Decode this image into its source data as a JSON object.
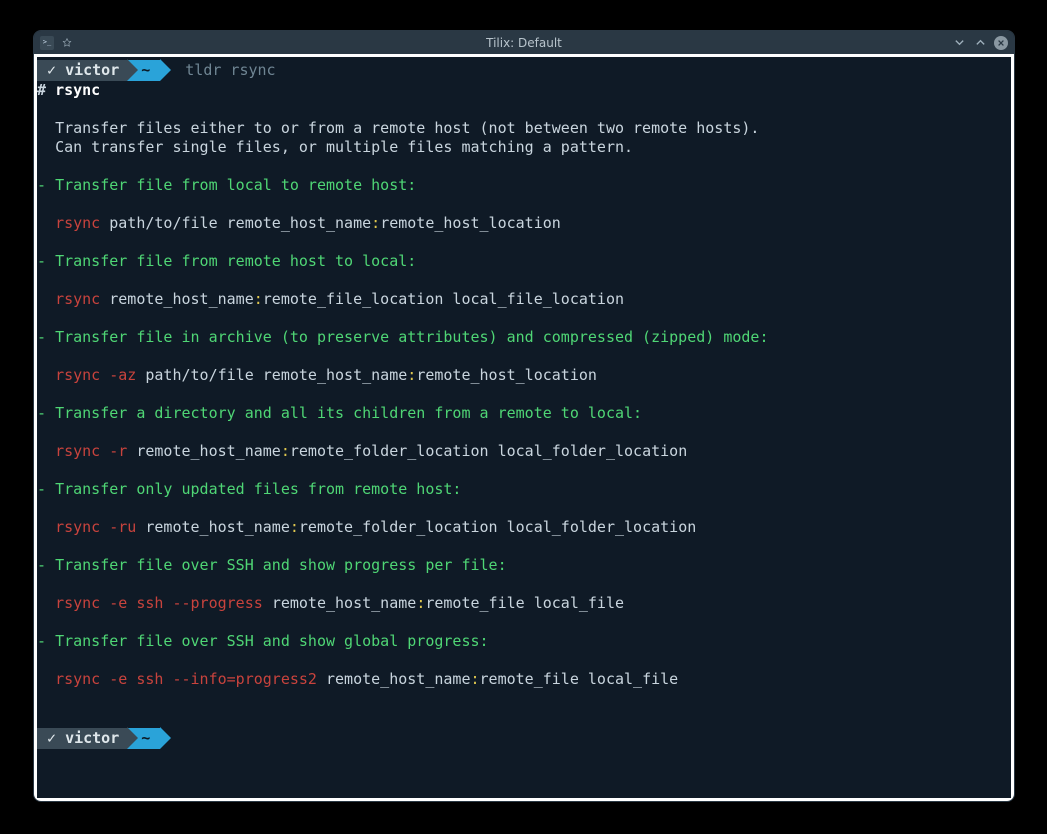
{
  "window": {
    "title": "Tilix: Default"
  },
  "prompt": {
    "check": "✓",
    "user": "victor",
    "cwd": "~",
    "command": "tldr rsync"
  },
  "output": {
    "heading_hash": "#",
    "heading": "rsync",
    "description_line1": "Transfer files either to or from a remote host (not between two remote hosts).",
    "description_line2": "Can transfer single files, or multiple files matching a pattern.",
    "examples": [
      {
        "desc": "Transfer file from local to remote host:",
        "cmd": "rsync",
        "flags": "",
        "seg": [
          {
            "t": "param",
            "v": "path/to/file remote_host_name"
          },
          {
            "t": "colon",
            "v": ":"
          },
          {
            "t": "param",
            "v": "remote_host_location"
          }
        ]
      },
      {
        "desc": "Transfer file from remote host to local:",
        "cmd": "rsync",
        "flags": "",
        "seg": [
          {
            "t": "param",
            "v": "remote_host_name"
          },
          {
            "t": "colon",
            "v": ":"
          },
          {
            "t": "param",
            "v": "remote_file_location local_file_location"
          }
        ]
      },
      {
        "desc": "Transfer file in archive (to preserve attributes) and compressed (zipped) mode:",
        "cmd": "rsync",
        "flags": "-az",
        "seg": [
          {
            "t": "param",
            "v": "path/to/file remote_host_name"
          },
          {
            "t": "colon",
            "v": ":"
          },
          {
            "t": "param",
            "v": "remote_host_location"
          }
        ]
      },
      {
        "desc": "Transfer a directory and all its children from a remote to local:",
        "cmd": "rsync",
        "flags": "-r",
        "seg": [
          {
            "t": "param",
            "v": "remote_host_name"
          },
          {
            "t": "colon",
            "v": ":"
          },
          {
            "t": "param",
            "v": "remote_folder_location local_folder_location"
          }
        ]
      },
      {
        "desc": "Transfer only updated files from remote host:",
        "cmd": "rsync",
        "flags": "-ru",
        "seg": [
          {
            "t": "param",
            "v": "remote_host_name"
          },
          {
            "t": "colon",
            "v": ":"
          },
          {
            "t": "param",
            "v": "remote_folder_location local_folder_location"
          }
        ]
      },
      {
        "desc": "Transfer file over SSH and show progress per file:",
        "cmd": "rsync",
        "flags": "-e ssh --progress",
        "seg": [
          {
            "t": "param",
            "v": "remote_host_name"
          },
          {
            "t": "colon",
            "v": ":"
          },
          {
            "t": "param",
            "v": "remote_file local_file"
          }
        ]
      },
      {
        "desc": "Transfer file over SSH and show global progress:",
        "cmd": "rsync",
        "flags": "-e ssh --info=progress2",
        "seg": [
          {
            "t": "param",
            "v": "remote_host_name"
          },
          {
            "t": "colon",
            "v": ":"
          },
          {
            "t": "param",
            "v": "remote_file local_file"
          }
        ]
      }
    ]
  }
}
